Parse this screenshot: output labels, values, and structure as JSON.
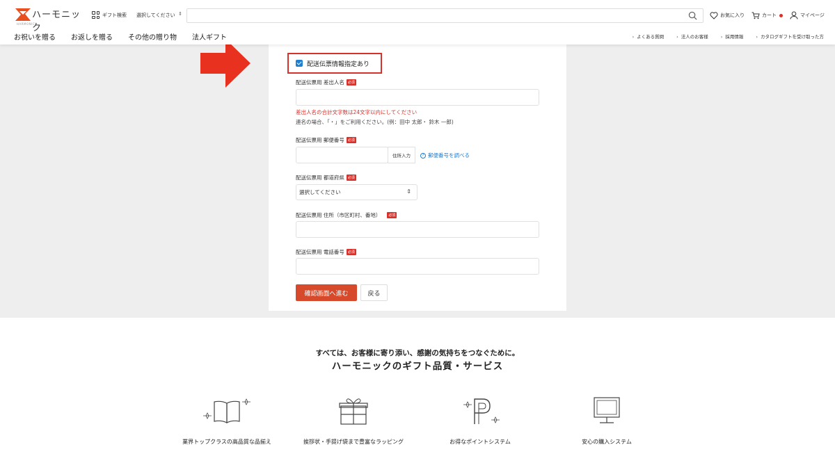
{
  "header": {
    "logo_text": "ハーモニック",
    "logo_sub": "HARMONICK",
    "gift_search_label": "ギフト検索",
    "category_select": "選択してください",
    "links": {
      "favorites": "お気に入り",
      "cart": "カート",
      "mypage": "マイページ"
    },
    "nav": [
      "お祝いを贈る",
      "お返しを贈る",
      "その他の贈り物",
      "法人ギフト"
    ],
    "sub_nav": [
      "よくある質問",
      "法人のお客様",
      "採用情報",
      "カタログギフトを受け取った方"
    ]
  },
  "form": {
    "checkbox_label": "配送伝票情報指定あり",
    "required_badge": "必須",
    "sender_label": "配送伝票用 差出人名",
    "sender_error": "差出人名の合計文字数は24文字以内にしてください",
    "sender_hint": "連名の場合、「・」をご利用ください。(例：田中 太郎・ 鈴木 一郎)",
    "zip_label": "配送伝票用 郵便番号",
    "zip_button": "住所入力",
    "zip_link": "郵便番号を調べる",
    "pref_label": "配送伝票用 都道府県",
    "pref_select": "選択してください",
    "address_label": "配送伝票用 住所（市区町村、番地）",
    "phone_label": "配送伝票用 電話番号",
    "confirm_button": "確認画面へ進む",
    "back_button": "戻る"
  },
  "promo": {
    "tagline": "すべては、お客様に寄り添い、感謝の気持ちをつなぐために。",
    "title": "ハーモニックのギフト品質・サービス",
    "features": [
      "業界トップクラスの高品質な品揃え",
      "挨拶状・手提げ袋まで豊富なラッピング",
      "お得なポイントシステム",
      "安心の購入システム"
    ]
  },
  "colors": {
    "accent_red": "#d6312a",
    "link_blue": "#1f7fd1",
    "page_gray": "#eeeeee"
  }
}
